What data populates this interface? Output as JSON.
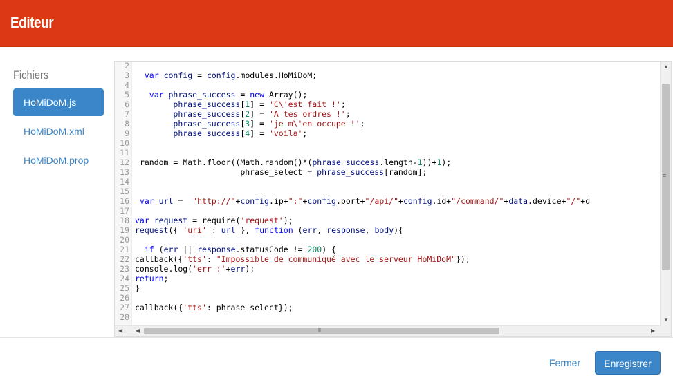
{
  "header": {
    "title": "Editeur"
  },
  "sidebar": {
    "heading": "Fichiers",
    "files": [
      {
        "label": "HoMiDoM.js",
        "active": true
      },
      {
        "label": "HoMiDoM.xml",
        "active": false
      },
      {
        "label": "HoMiDoM.prop",
        "active": false
      }
    ]
  },
  "editor": {
    "line_numbers": [
      "2",
      "3",
      "4",
      "5",
      "6",
      "7",
      "8",
      "9",
      "10",
      "11",
      "12",
      "13",
      "14",
      "15",
      "16",
      "17",
      "18",
      "19",
      "20",
      "21",
      "22",
      "23",
      "24",
      "25",
      "26",
      "27",
      "28"
    ],
    "lines": [
      "",
      "  var config = config.modules.HoMiDoM;",
      "",
      "   var phrase_success = new Array();",
      "        phrase_success[1] = 'C\\'est fait !';",
      "        phrase_success[2] = 'A tes ordres !';",
      "        phrase_success[3] = 'je m\\'en occupe !';",
      "        phrase_success[4] = 'voila';",
      "",
      "",
      " random = Math.floor((Math.random()*(phrase_success.length-1))+1);",
      "                      phrase_select = phrase_success[random];",
      "",
      "",
      " var url =  \"http://\"+config.ip+\":\"+config.port+\"/api/\"+config.id+\"/command/\"+data.device+\"/\"+d",
      "",
      "var request = require('request');",
      "request({ 'uri' : url }, function (err, response, body){",
      "",
      "  if (err || response.statusCode != 200) {",
      "callback({'tts': \"Impossible de communiqué avec le serveur HoMiDoM\"});",
      "console.log('err :'+err);",
      "return;",
      "}",
      "",
      "callback({'tts': phrase_select});",
      ""
    ]
  },
  "footer": {
    "close_label": "Fermer",
    "save_label": "Enregistrer"
  },
  "colors": {
    "header": "#dd3815",
    "accent": "#3a86c8"
  }
}
